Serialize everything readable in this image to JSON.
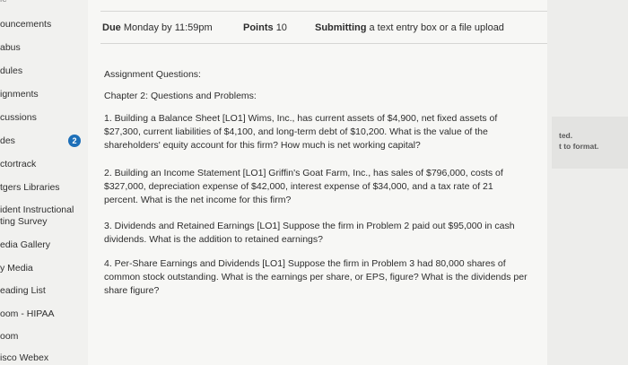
{
  "sidebar": {
    "items": [
      {
        "label": "ouncements"
      },
      {
        "label": "abus"
      },
      {
        "label": "dules"
      },
      {
        "label": "ignments"
      },
      {
        "label": "cussions"
      },
      {
        "label": "des",
        "badge": "2"
      },
      {
        "label": "ctortrack"
      },
      {
        "label": "tgers Libraries"
      },
      {
        "label": "ident Instructional"
      },
      {
        "label": "ting Survey"
      },
      {
        "label": "edia Gallery"
      },
      {
        "label": "y Media"
      },
      {
        "label": "eading List"
      },
      {
        "label": "oom - HIPAA"
      },
      {
        "label": "oom"
      },
      {
        "label": "isco Webex"
      }
    ],
    "top_fragment": "ie"
  },
  "assignment": {
    "due_label": "Due",
    "due_value": "Monday by 11:59pm",
    "points_label": "Points",
    "points_value": "10",
    "submitting_label": "Submitting",
    "submitting_value": "a text entry box or a file upload",
    "heading": "Assignment Questions:",
    "chapter": "Chapter 2: Questions and Problems:",
    "questions": [
      "1. Building a Balance Sheet [LO1] Wims, Inc., has current assets of $4,900, net fixed assets of $27,300, current liabilities of $4,100, and long-term debt of $10,200. What is the value of the shareholders' equity account for this firm? How much is net working capital?",
      "2. Building an Income Statement [LO1] Griffin's Goat Farm, Inc., has sales of $796,000, costs of $327,000, depreciation expense of $42,000, interest expense of $34,000, and a tax rate of 21 percent. What is the net income for this firm?",
      "3. Dividends and Retained Earnings [LO1] Suppose the firm in Problem 2 paid out $95,000 in cash dividends. What is the addition to retained earnings?",
      "4. Per-Share Earnings and Dividends [LO1] Suppose the firm in Problem 3 had 80,000 shares of common stock outstanding. What is the earnings per share, or EPS, figure? What is the dividends per share figure?"
    ]
  },
  "right_panel": {
    "line1": "ted.",
    "line2": "t to format."
  }
}
